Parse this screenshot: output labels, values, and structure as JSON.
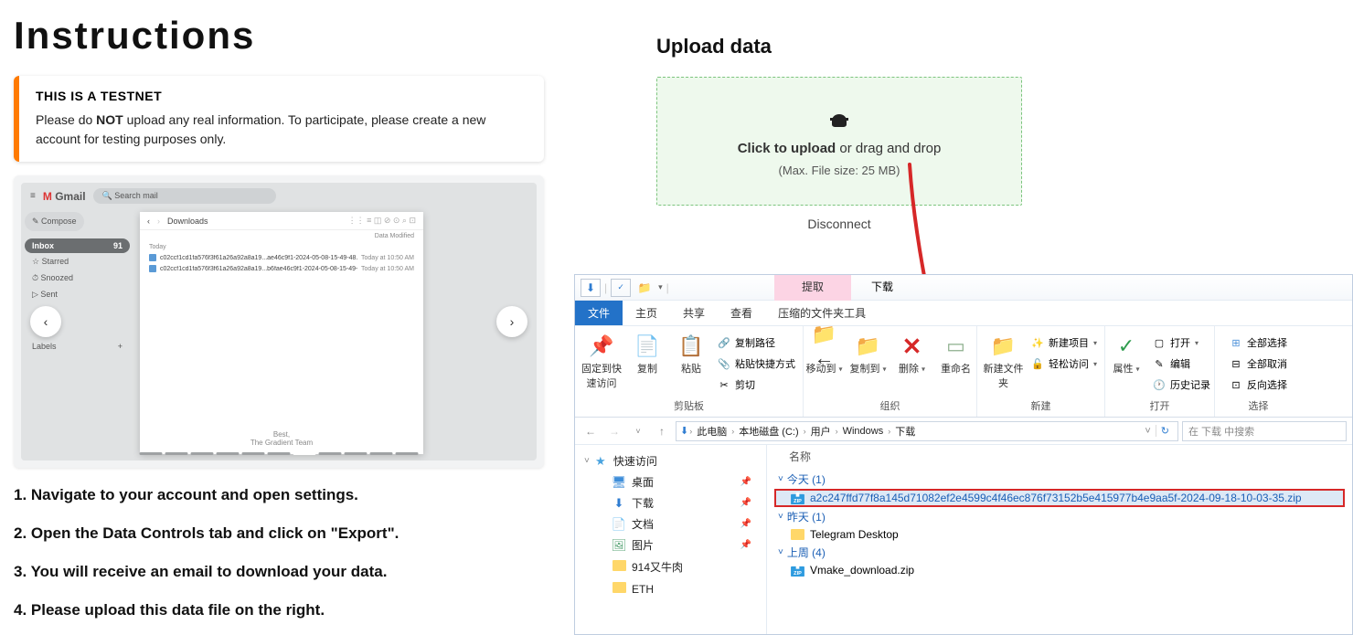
{
  "page_title": "Instructions",
  "warning": {
    "title": "THIS IS A TESTNET",
    "text_pre": "Please do ",
    "text_bold": "NOT",
    "text_post": " upload any real information. To participate, please create a new account for testing purposes only."
  },
  "gmail": {
    "logo": "Gmail",
    "search": "Search mail",
    "compose": "Compose",
    "sidebar": {
      "inbox": "Inbox",
      "inbox_count": "91",
      "starred": "Starred",
      "snoozed": "Snoozed",
      "sent": "Sent",
      "labels": "Labels"
    },
    "dialog": {
      "location": "Downloads",
      "col_date": "Data Modified",
      "today": "Today",
      "row1_name": "c02ccf1cd1fa576f3f61a26a92a8a19...ae46c9f1-2024-05-08-15-49-48.zip",
      "row1_date": "Today at 10:50 AM",
      "row2_name": "c02ccf1cd1fa576f3f61a26a92a8a19...b6fae46c9f1-2024-05-08-15-49-48",
      "row2_date": "Today at 10:50 AM",
      "footer1": "Best,",
      "footer2": "The Gradient Team"
    }
  },
  "steps": {
    "s1": "1. Navigate to your account and open settings.",
    "s2": "2. Open the Data Controls tab and click on \"Export\".",
    "s3": "3. You will receive an email to download your data.",
    "s4": "4. Please upload this data file on the right."
  },
  "upload": {
    "heading": "Upload data",
    "click": "Click to upload",
    "drag": " or drag and drop",
    "max": "(Max. File size: 25 MB)",
    "disconnect": "Disconnect"
  },
  "explorer": {
    "context_tab_highlight": "提取",
    "context_tab_dl": "下载",
    "context_label": "压缩的文件夹工具",
    "tabs": {
      "file": "文件",
      "home": "主页",
      "share": "共享",
      "view": "查看"
    },
    "ribbon": {
      "pin": "固定到快速访问",
      "copy": "复制",
      "paste": "粘贴",
      "copy_path": "复制路径",
      "paste_shortcut": "粘贴快捷方式",
      "cut": "剪切",
      "g_clipboard": "剪贴板",
      "move_to": "移动到",
      "copy_to": "复制到",
      "delete": "删除",
      "rename": "重命名",
      "g_organize": "组织",
      "new_folder": "新建文件夹",
      "new_item": "新建项目",
      "easy_access": "轻松访问",
      "g_new": "新建",
      "properties": "属性",
      "open": "打开",
      "edit": "编辑",
      "history": "历史记录",
      "g_open": "打开",
      "select_all": "全部选择",
      "select_none": "全部取消",
      "invert": "反向选择",
      "g_select": "选择"
    },
    "breadcrumb": {
      "pc": "此电脑",
      "disk": "本地磁盘 (C:)",
      "user": "用户",
      "windows": "Windows",
      "downloads": "下载"
    },
    "search_placeholder": "在 下载 中搜索",
    "sidebar": {
      "quick": "快速访问",
      "desktop": "桌面",
      "downloads": "下载",
      "documents": "文档",
      "pictures": "图片",
      "folder1": "914又牛肉",
      "folder2": "ETH"
    },
    "main": {
      "col_name": "名称",
      "today": "今天 (1)",
      "file_sel": "a2c247ffd77f8a145d71082ef2e4599c4f46ec876f73152b5e415977b4e9aa5f-2024-09-18-10-03-35.zip",
      "yesterday": "昨天 (1)",
      "file_telegram": "Telegram Desktop",
      "lastweek": "上周 (4)",
      "file_vmake": "Vmake_download.zip"
    }
  }
}
